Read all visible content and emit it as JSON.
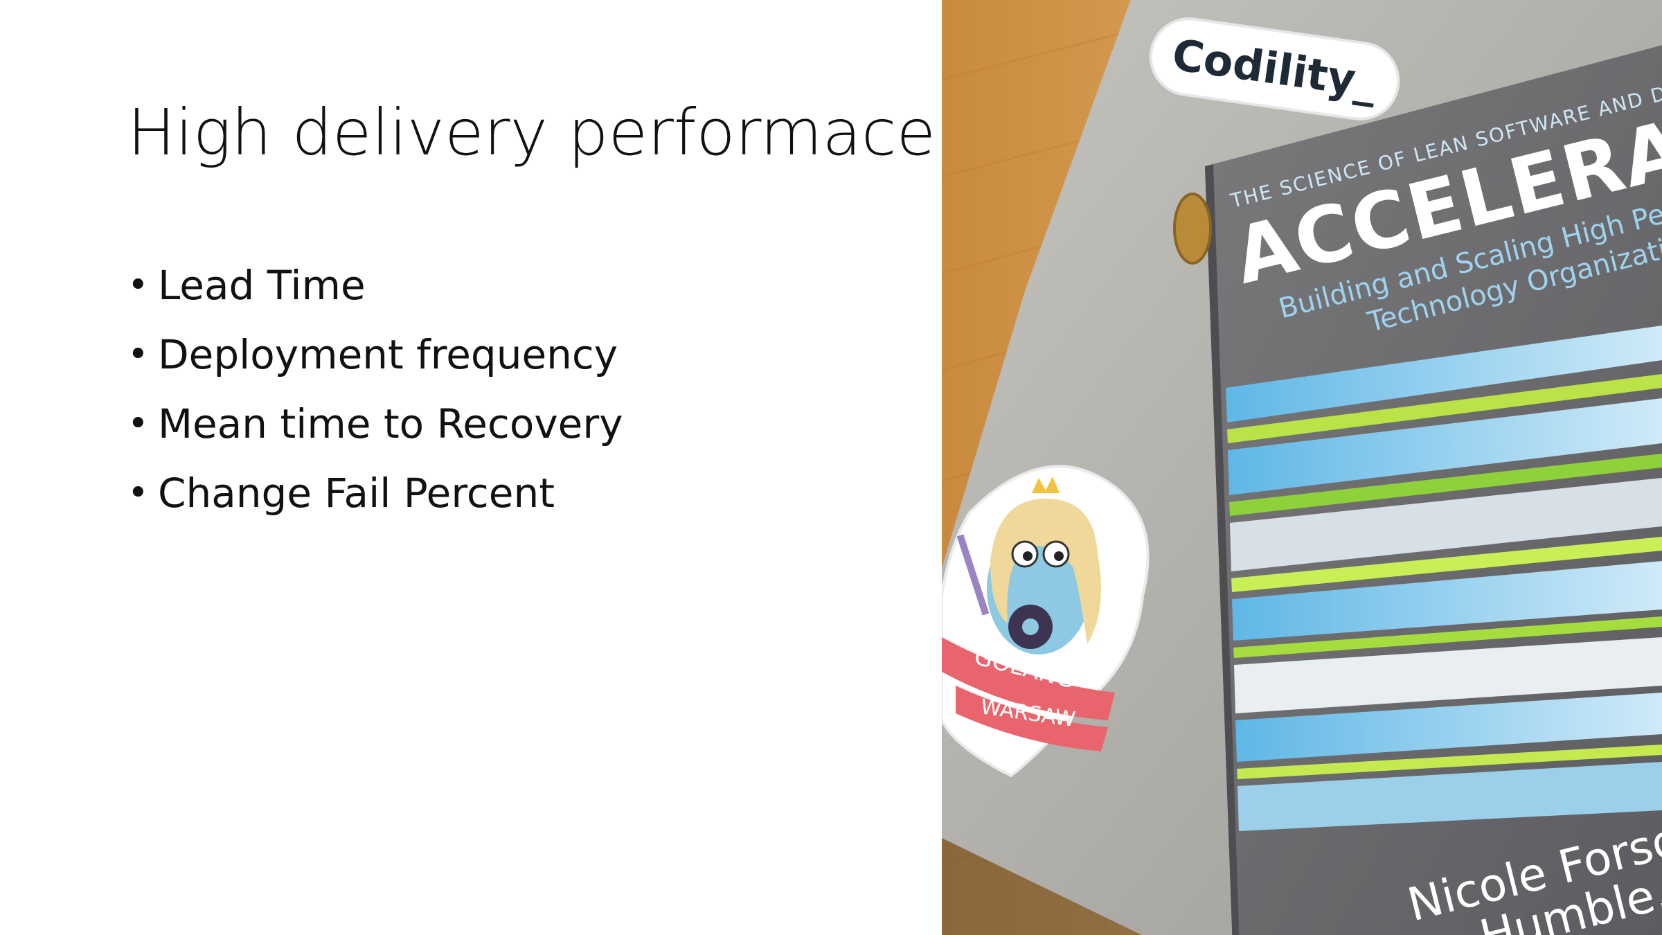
{
  "slide": {
    "title": "High delivery performace",
    "bullets": [
      "Lead Time",
      "Deployment frequency",
      "Mean time to Recovery",
      "Change Fail Percent"
    ],
    "bullet_glyph": "•"
  },
  "photo": {
    "laptop_sticker": "Codility_",
    "book": {
      "series_line": "THE SCIENCE OF LEAN SOFTWARE AND DE",
      "title": "ACCELERAT",
      "subtitle_line1": "Building and Scaling High Perfor",
      "subtitle_line2": "Technology Organizations",
      "author_line1": "Nicole Forsg",
      "author_line2": "Humble, ar"
    },
    "gopher_sticker": {
      "line1": "GOLANG",
      "line2": "WARSAW"
    }
  },
  "colors": {
    "background": "#ffffff",
    "text": "#111111",
    "wood": "#d39a4e",
    "laptop": "#b8b6b1",
    "book_cover": "#6e6e70",
    "book_title": "#ffffff",
    "book_subtitle": "#9fd3ef",
    "ribbon": "#e8656e"
  }
}
